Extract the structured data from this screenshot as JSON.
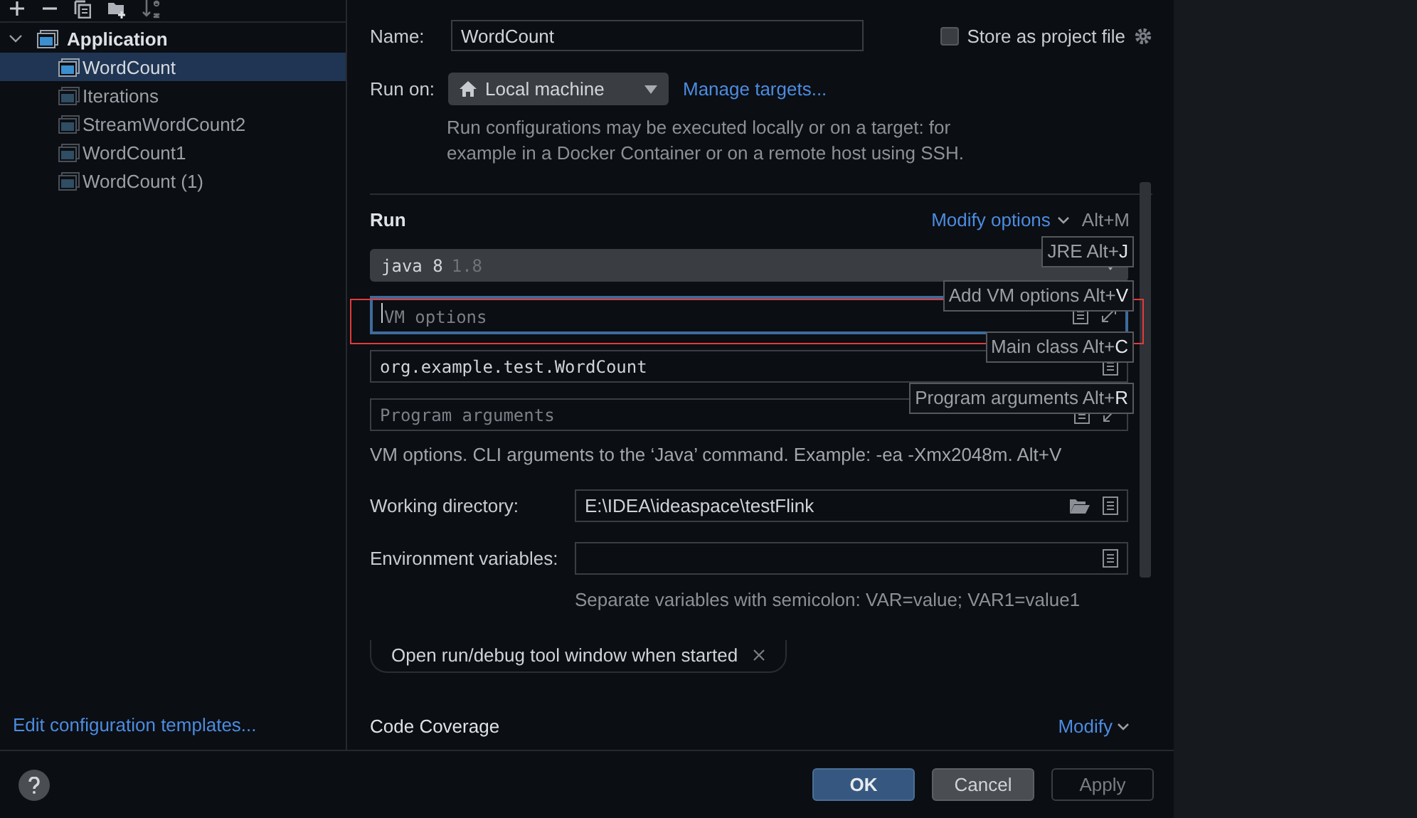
{
  "tree": [
    {
      "label": "Application",
      "expanded": true,
      "children": [
        {
          "label": "WordCount",
          "selected": true
        },
        {
          "label": "Iterations",
          "selected": false
        },
        {
          "label": "StreamWordCount2",
          "selected": false
        },
        {
          "label": "WordCount1",
          "selected": false
        },
        {
          "label": "WordCount (1)",
          "selected": false
        }
      ]
    }
  ],
  "sidebar_link": "Edit configuration templates...",
  "form": {
    "name": {
      "label": "Name:",
      "value": "WordCount"
    },
    "store": {
      "label": "Store as project file",
      "checked": false
    },
    "run_on": {
      "label": "Run on:",
      "value": "Local machine",
      "link": "Manage targets...",
      "note": "Run configurations may be executed locally or on a target: for example in a Docker Container or on a remote host using SSH."
    },
    "run": {
      "title": "Run",
      "modify": "Modify options",
      "shortcut": "Alt+M",
      "jre": {
        "value": "java 8",
        "version": "1.8"
      },
      "fields": [
        {
          "placeholder": "VM options",
          "focused": true
        },
        {
          "value": "org.example.test.WordCount",
          "focused": false
        },
        {
          "placeholder": "Program arguments",
          "focused": false
        }
      ],
      "hint": "VM options. CLI arguments to the ‘Java’ command. Example: -ea -Xmx2048m. Alt+V",
      "working_directory": {
        "label": "Working directory:",
        "value": "E:\\IDEA\\ideaspace\\testFlink"
      },
      "environment": {
        "label": "Environment variables:",
        "hint": "Separate variables with semicolon: VAR=value; VAR1=value1"
      },
      "chip": "Open run/debug tool window when started"
    },
    "code_coverage": {
      "title": "Code Coverage",
      "modify": "Modify"
    }
  },
  "tooltips": [
    "JRE Alt+**J**",
    "Add VM options Alt+**V**",
    "Main class Alt+**C**",
    "Program arguments Alt+**R**"
  ],
  "buttons": [
    {
      "label": "OK",
      "kind": "primary"
    },
    {
      "label": "Cancel",
      "kind": "secondary"
    },
    {
      "label": "Apply",
      "kind": "disabled"
    }
  ]
}
